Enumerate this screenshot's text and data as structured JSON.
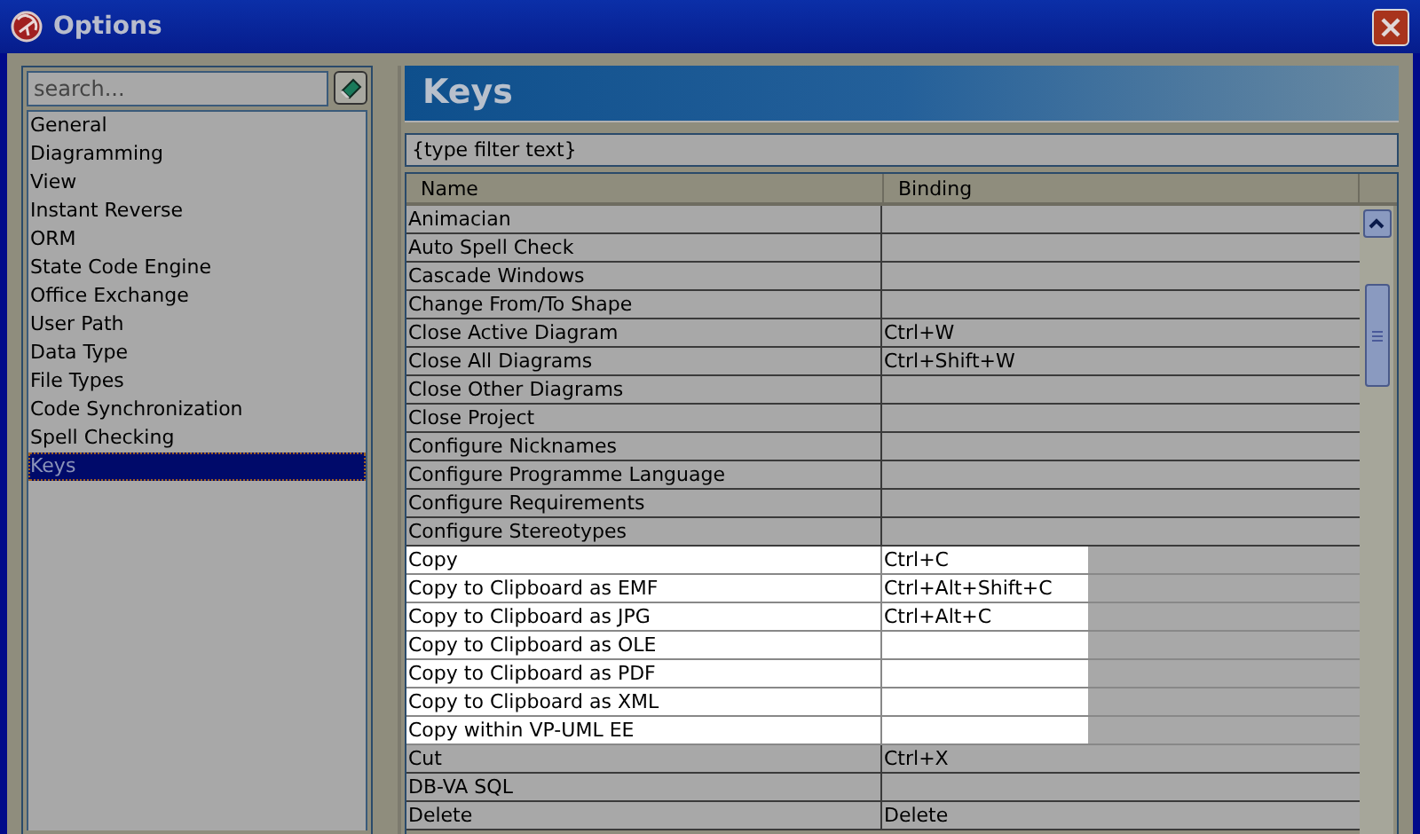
{
  "window": {
    "title": "Options"
  },
  "sidebar": {
    "search": {
      "placeholder": "search..."
    },
    "items": [
      {
        "label": "General",
        "selected": false
      },
      {
        "label": "Diagramming",
        "selected": false
      },
      {
        "label": "View",
        "selected": false
      },
      {
        "label": "Instant Reverse",
        "selected": false
      },
      {
        "label": "ORM",
        "selected": false
      },
      {
        "label": "State Code Engine",
        "selected": false
      },
      {
        "label": "Office Exchange",
        "selected": false
      },
      {
        "label": "User Path",
        "selected": false
      },
      {
        "label": "Data Type",
        "selected": false
      },
      {
        "label": "File Types",
        "selected": false
      },
      {
        "label": "Code Synchronization",
        "selected": false
      },
      {
        "label": "Spell Checking",
        "selected": false
      },
      {
        "label": "Keys",
        "selected": true
      }
    ]
  },
  "panel": {
    "title": "Keys",
    "filter": {
      "placeholder": "{type filter text}"
    },
    "table": {
      "columns": [
        "Name",
        "Binding"
      ],
      "rows": [
        {
          "name": "Animacian",
          "binding": "",
          "highlighted": false
        },
        {
          "name": "Auto Spell Check",
          "binding": "",
          "highlighted": false
        },
        {
          "name": "Cascade Windows",
          "binding": "",
          "highlighted": false
        },
        {
          "name": "Change From/To Shape",
          "binding": "",
          "highlighted": false
        },
        {
          "name": "Close Active Diagram",
          "binding": "Ctrl+W",
          "highlighted": false
        },
        {
          "name": "Close All Diagrams",
          "binding": "Ctrl+Shift+W",
          "highlighted": false
        },
        {
          "name": "Close Other Diagrams",
          "binding": "",
          "highlighted": false
        },
        {
          "name": "Close Project",
          "binding": "",
          "highlighted": false
        },
        {
          "name": "Configure Nicknames",
          "binding": "",
          "highlighted": false
        },
        {
          "name": "Configure Programme Language",
          "binding": "",
          "highlighted": false
        },
        {
          "name": "Configure Requirements",
          "binding": "",
          "highlighted": false
        },
        {
          "name": "Configure Stereotypes",
          "binding": "",
          "highlighted": false
        },
        {
          "name": "Copy",
          "binding": "Ctrl+C",
          "highlighted": true
        },
        {
          "name": "Copy to Clipboard as EMF",
          "binding": "Ctrl+Alt+Shift+C",
          "highlighted": true
        },
        {
          "name": "Copy to Clipboard as JPG",
          "binding": "Ctrl+Alt+C",
          "highlighted": true
        },
        {
          "name": "Copy to Clipboard as OLE",
          "binding": "",
          "highlighted": true
        },
        {
          "name": "Copy to Clipboard as PDF",
          "binding": "",
          "highlighted": true
        },
        {
          "name": "Copy to Clipboard as XML",
          "binding": "",
          "highlighted": true
        },
        {
          "name": "Copy within VP-UML EE",
          "binding": "",
          "highlighted": true
        },
        {
          "name": "Cut",
          "binding": "Ctrl+X",
          "highlighted": false
        },
        {
          "name": "DB-VA SQL",
          "binding": "",
          "highlighted": false
        },
        {
          "name": "Delete",
          "binding": "Delete",
          "highlighted": false
        }
      ]
    }
  }
}
